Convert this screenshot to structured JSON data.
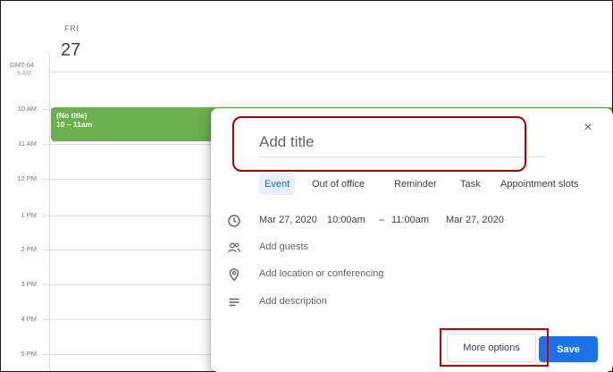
{
  "header": {
    "day_name": "FRI",
    "day_number": "27",
    "timezone": "GMT-04",
    "cut_label": "9 AM"
  },
  "hours": [
    "10 AM",
    "11 AM",
    "12 PM",
    "1 PM",
    "2 PM",
    "3 PM",
    "4 PM",
    "5 PM"
  ],
  "event": {
    "title": "(No title)",
    "time": "10 – 11am",
    "color": "#6ab04c"
  },
  "dialog": {
    "title_placeholder": "Add title",
    "close_symbol": "×",
    "tabs": [
      "Event",
      "Out of office",
      "Reminder",
      "Task",
      "Appointment slots"
    ],
    "active_tab": "Event",
    "datetime": {
      "start_date": "Mar 27, 2020",
      "start_time": "10:00am",
      "separator": "–",
      "end_time": "11:00am",
      "end_date": "Mar 27, 2020"
    },
    "add_guests": "Add guests",
    "add_location": "Add location or conferencing",
    "add_description": "Add description",
    "more_options": "More options",
    "save": "Save"
  },
  "colors": {
    "accent": "#1a73e8",
    "highlight": "#c00000"
  }
}
